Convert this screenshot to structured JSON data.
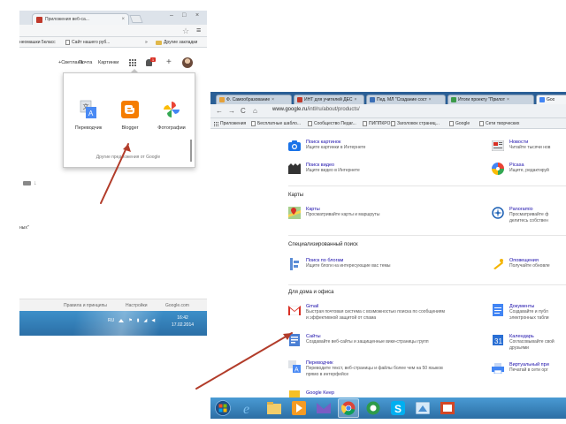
{
  "left": {
    "tab": {
      "title": "Приложения веб-са...",
      "close": "×"
    },
    "window_buttons": [
      "–",
      "□",
      "×"
    ],
    "bookmarks": [
      {
        "label": "неомашки 5класс"
      },
      {
        "label": "Сайт нашего руб..."
      },
      {
        "label": "»"
      },
      {
        "label": "Другие закладки"
      }
    ],
    "google_bar": {
      "links": [
        "+Светлана",
        "Почта",
        "Картинки"
      ],
      "notif_count": "1",
      "plus": "+"
    },
    "popup": {
      "apps": [
        {
          "label": "Переводчик"
        },
        {
          "label": "Blogger"
        },
        {
          "label": "Фотографии"
        }
      ],
      "more": "Другие предложения от Google"
    },
    "snippet": "<b>ных</b>",
    "footer": [
      "Правила и принципы",
      "Настройки",
      "Google.com"
    ],
    "tray": {
      "lang": "RU",
      "time": "16:42",
      "date": "17.02.2014"
    }
  },
  "right": {
    "tabs": [
      {
        "title": "Ф. Самообразование",
        "color": "#e5a13a",
        "active": false
      },
      {
        "title": "ИНТ для учителей ДЕС",
        "color": "#c0392b",
        "active": false
      },
      {
        "title": "Пед. МЛ \"Создание сост",
        "color": "#3b6fb6",
        "active": false
      },
      {
        "title": "Итоги проекту \"Прилот",
        "color": "#3c9b4a",
        "active": false
      },
      {
        "title": "Goo",
        "color": "#4285f4",
        "active": true
      }
    ],
    "nav": {
      "back": "←",
      "forward": "→",
      "reload": "C",
      "home": "⌂"
    },
    "url": {
      "host": "www.google.ru",
      "path": "/intl/ru/about/products/"
    },
    "bookmarks": [
      {
        "label": "Приложения",
        "type": "apps"
      },
      {
        "label": "Бесплатные шабло...",
        "type": "doc"
      },
      {
        "label": "Сообщество Педаг...",
        "type": "doc"
      },
      {
        "label": "ПИППКРО",
        "type": "doc"
      },
      {
        "label": "Заголовок страниц...",
        "type": "doc"
      },
      {
        "label": "Google",
        "type": "doc"
      },
      {
        "label": "Сети творческих",
        "type": "doc"
      }
    ],
    "left_col": [
      {
        "name": "Поиск картинок",
        "desc": [
          "Ищите картинки в Интернете"
        ],
        "icon": "camera-icon"
      },
      {
        "name": "Поиск видео",
        "desc": [
          "Ищите видео в Интернете"
        ],
        "icon": "video-icon"
      },
      {
        "name": "Карты",
        "desc": [
          "Просматривайте карты и маршруты"
        ],
        "icon": "maps-icon"
      },
      {
        "name": "Поиск по блогам",
        "desc": [
          "Ищите блоги на интересующие вас темы"
        ],
        "icon": "blogsearch-icon"
      },
      {
        "name": "Gmail",
        "desc": [
          "Быстрая почтовая система с возможностью поиска по сообщениям",
          "и эффективной защитой от спама"
        ],
        "icon": "gmail-icon"
      },
      {
        "name": "Сайты",
        "desc": [
          "Создавайте веб-сайты и защищенные вики-страницы групп"
        ],
        "icon": "sites-icon"
      },
      {
        "name": "Переводчик",
        "desc": [
          "Переводите текст, веб-страницы и файлы более чем на 50 языков",
          "прямо в интерфейсе"
        ],
        "icon": "translate-icon"
      },
      {
        "name": "Google Keep",
        "desc": [],
        "icon": "keep-icon"
      }
    ],
    "right_col": [
      {
        "name": "Новости",
        "desc": [
          "Читайте тысячи нов"
        ],
        "icon": "news-icon"
      },
      {
        "name": "Picasa",
        "desc": [
          "Ищите, редактируй"
        ],
        "icon": "picasa-icon"
      },
      {
        "name": "Panoramio",
        "desc": [
          "Просматривайте ф",
          "делитесь собствен"
        ],
        "icon": "panoramio-icon"
      },
      {
        "name": "Оповещения",
        "desc": [
          "Получайте обновле"
        ],
        "icon": "alerts-icon"
      },
      {
        "name": "Документы",
        "desc": [
          "Создавайте и публ",
          "электронных табли"
        ],
        "icon": "docs-icon"
      },
      {
        "name": "Календарь",
        "desc": [
          "Согласовывайте свой",
          "друзьями"
        ],
        "icon": "calendar-icon"
      },
      {
        "name": "Виртуальный при",
        "desc": [
          "Печатай в сети орг"
        ],
        "icon": "cloudprint-icon"
      }
    ],
    "sections": [
      "Карты",
      "Специализированный поиск",
      "Для дома и офиса"
    ]
  }
}
